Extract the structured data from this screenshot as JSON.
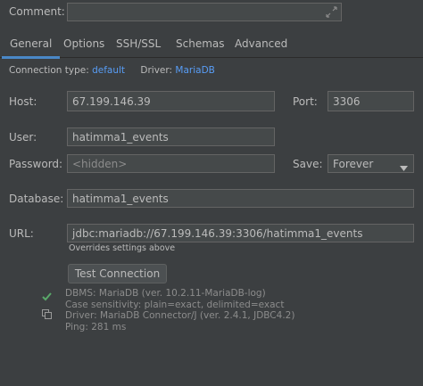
{
  "comment": {
    "label": "Comment:",
    "value": ""
  },
  "tabs": [
    {
      "label": "General"
    },
    {
      "label": "Options"
    },
    {
      "label": "SSH/SSL"
    },
    {
      "label": "Schemas"
    },
    {
      "label": "Advanced"
    }
  ],
  "connection": {
    "type_label": "Connection type:",
    "type_value": "default",
    "driver_label": "Driver:",
    "driver_value": "MariaDB"
  },
  "host": {
    "label": "Host:",
    "value": "67.199.146.39"
  },
  "port": {
    "label": "Port:",
    "value": "3306"
  },
  "user": {
    "label": "User:",
    "value": "hatimma1_events"
  },
  "password": {
    "label": "Password:",
    "placeholder": "<hidden>"
  },
  "save": {
    "label": "Save:",
    "value": "Forever"
  },
  "database": {
    "label": "Database:",
    "value": "hatimma1_events"
  },
  "url": {
    "label": "URL:",
    "value": "jdbc:mariadb://67.199.146.39:3306/hatimma1_events",
    "note": "Overrides settings above"
  },
  "test_button": {
    "label": "Test Connection"
  },
  "test_result": {
    "lines": [
      "DBMS: MariaDB (ver. 10.2.11-MariaDB-log)",
      "Case sensitivity: plain=exact, delimited=exact",
      "Driver: MariaDB Connector/J (ver. 2.4.1, JDBC4.2)",
      "Ping: 281 ms"
    ]
  },
  "colors": {
    "background": "#3c3f41",
    "field": "#45494a",
    "accent": "#4a88c7",
    "link": "#589df6",
    "success": "#59a869"
  },
  "icons": [
    "expand-icon",
    "dropdown-arrow-icon",
    "checkmark-icon",
    "copy-icon"
  ]
}
